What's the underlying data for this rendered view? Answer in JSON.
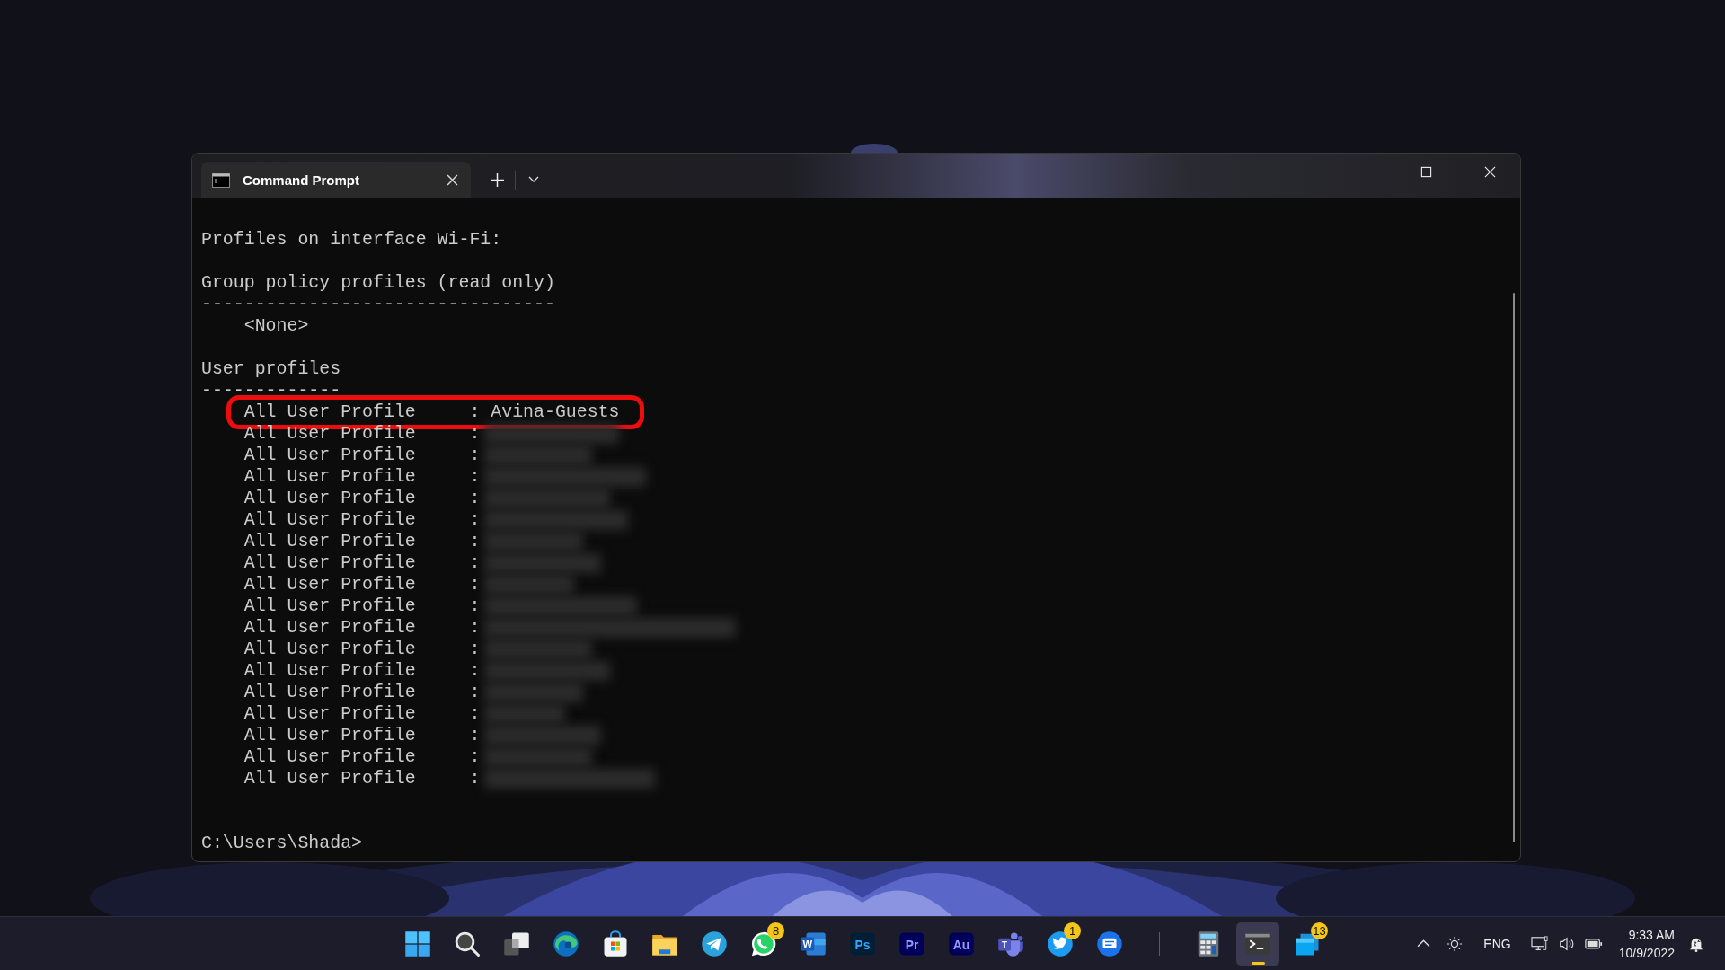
{
  "window": {
    "tab": {
      "title": "Command Prompt",
      "selected": true
    }
  },
  "terminal": {
    "header": "Profiles on interface Wi-Fi:",
    "group_heading": "Group policy profiles (read only)",
    "group_rule": "---------------------------------",
    "group_none": "<None>",
    "user_heading": "User profiles",
    "user_rule": "-------------",
    "profiles": [
      {
        "text": "All User Profile     : Avina-Guests",
        "highlighted": true,
        "redacted": false
      },
      {
        "text": "All User Profile     :",
        "highlighted": false,
        "redacted": true
      },
      {
        "text": "All User Profile     :",
        "highlighted": false,
        "redacted": true
      },
      {
        "text": "All User Profile     :",
        "highlighted": false,
        "redacted": true
      },
      {
        "text": "All User Profile     :",
        "highlighted": false,
        "redacted": true
      },
      {
        "text": "All User Profile     :",
        "highlighted": false,
        "redacted": true
      },
      {
        "text": "All User Profile     :",
        "highlighted": false,
        "redacted": true
      },
      {
        "text": "All User Profile     :",
        "highlighted": false,
        "redacted": true
      },
      {
        "text": "All User Profile     :",
        "highlighted": false,
        "redacted": true
      },
      {
        "text": "All User Profile     :",
        "highlighted": false,
        "redacted": true
      },
      {
        "text": "All User Profile     :",
        "highlighted": false,
        "redacted": true
      },
      {
        "text": "All User Profile     :",
        "highlighted": false,
        "redacted": true
      },
      {
        "text": "All User Profile     :",
        "highlighted": false,
        "redacted": true
      },
      {
        "text": "All User Profile     :",
        "highlighted": false,
        "redacted": true
      },
      {
        "text": "All User Profile     :",
        "highlighted": false,
        "redacted": true
      },
      {
        "text": "All User Profile     :",
        "highlighted": false,
        "redacted": true
      },
      {
        "text": "All User Profile     :",
        "highlighted": false,
        "redacted": true
      },
      {
        "text": "All User Profile     :",
        "highlighted": false,
        "redacted": true
      }
    ],
    "prompt": "C:\\Users\\Shada>"
  },
  "taskbar": {
    "items": [
      {
        "kind": "start",
        "active": false
      },
      {
        "kind": "search",
        "active": false
      },
      {
        "kind": "taskview",
        "active": false
      },
      {
        "kind": "edge",
        "active": false
      },
      {
        "kind": "store",
        "active": false
      },
      {
        "kind": "folder",
        "active": false
      },
      {
        "kind": "telegram",
        "active": false
      },
      {
        "kind": "whatsapp",
        "badge": "8",
        "active": false
      },
      {
        "kind": "word",
        "label": "W",
        "active": false
      },
      {
        "kind": "adobe",
        "label": "Ps",
        "active": false
      },
      {
        "kind": "adobe",
        "label": "Pr",
        "active": false
      },
      {
        "kind": "adobe",
        "label": "Au",
        "active": false
      },
      {
        "kind": "teams",
        "label": "T",
        "active": false
      },
      {
        "kind": "twitter",
        "badge": "1",
        "active": false
      },
      {
        "kind": "messages",
        "active": false
      },
      {
        "kind": "separator"
      },
      {
        "kind": "calculator",
        "active": false
      },
      {
        "kind": "terminal",
        "active": true
      },
      {
        "kind": "tiles",
        "badge": "13",
        "active": false
      }
    ]
  },
  "tray": {
    "language": "ENG",
    "time": "9:33 AM",
    "date": "10/9/2022"
  }
}
